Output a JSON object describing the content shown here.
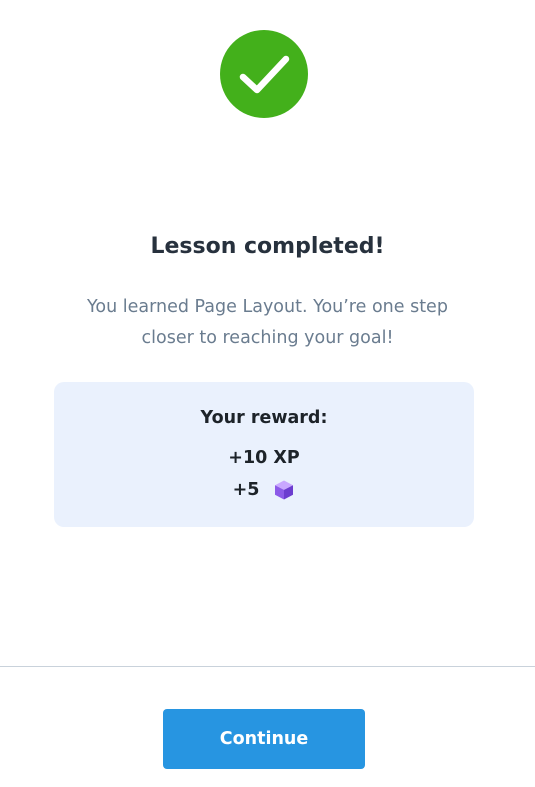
{
  "success_icon": {
    "icon": "checkmark-icon",
    "color": "#43b01b"
  },
  "title": "Lesson completed!",
  "message": "You learned Page Layout. You’re one step closer to reaching your goal!",
  "reward": {
    "heading": "Your reward:",
    "xp": "+10 XP",
    "gems": "+5",
    "gem_icon": "gem-cube-icon",
    "background": "#eaf1fd"
  },
  "footer": {
    "continue_label": "Continue",
    "button_color": "#2795e1"
  }
}
